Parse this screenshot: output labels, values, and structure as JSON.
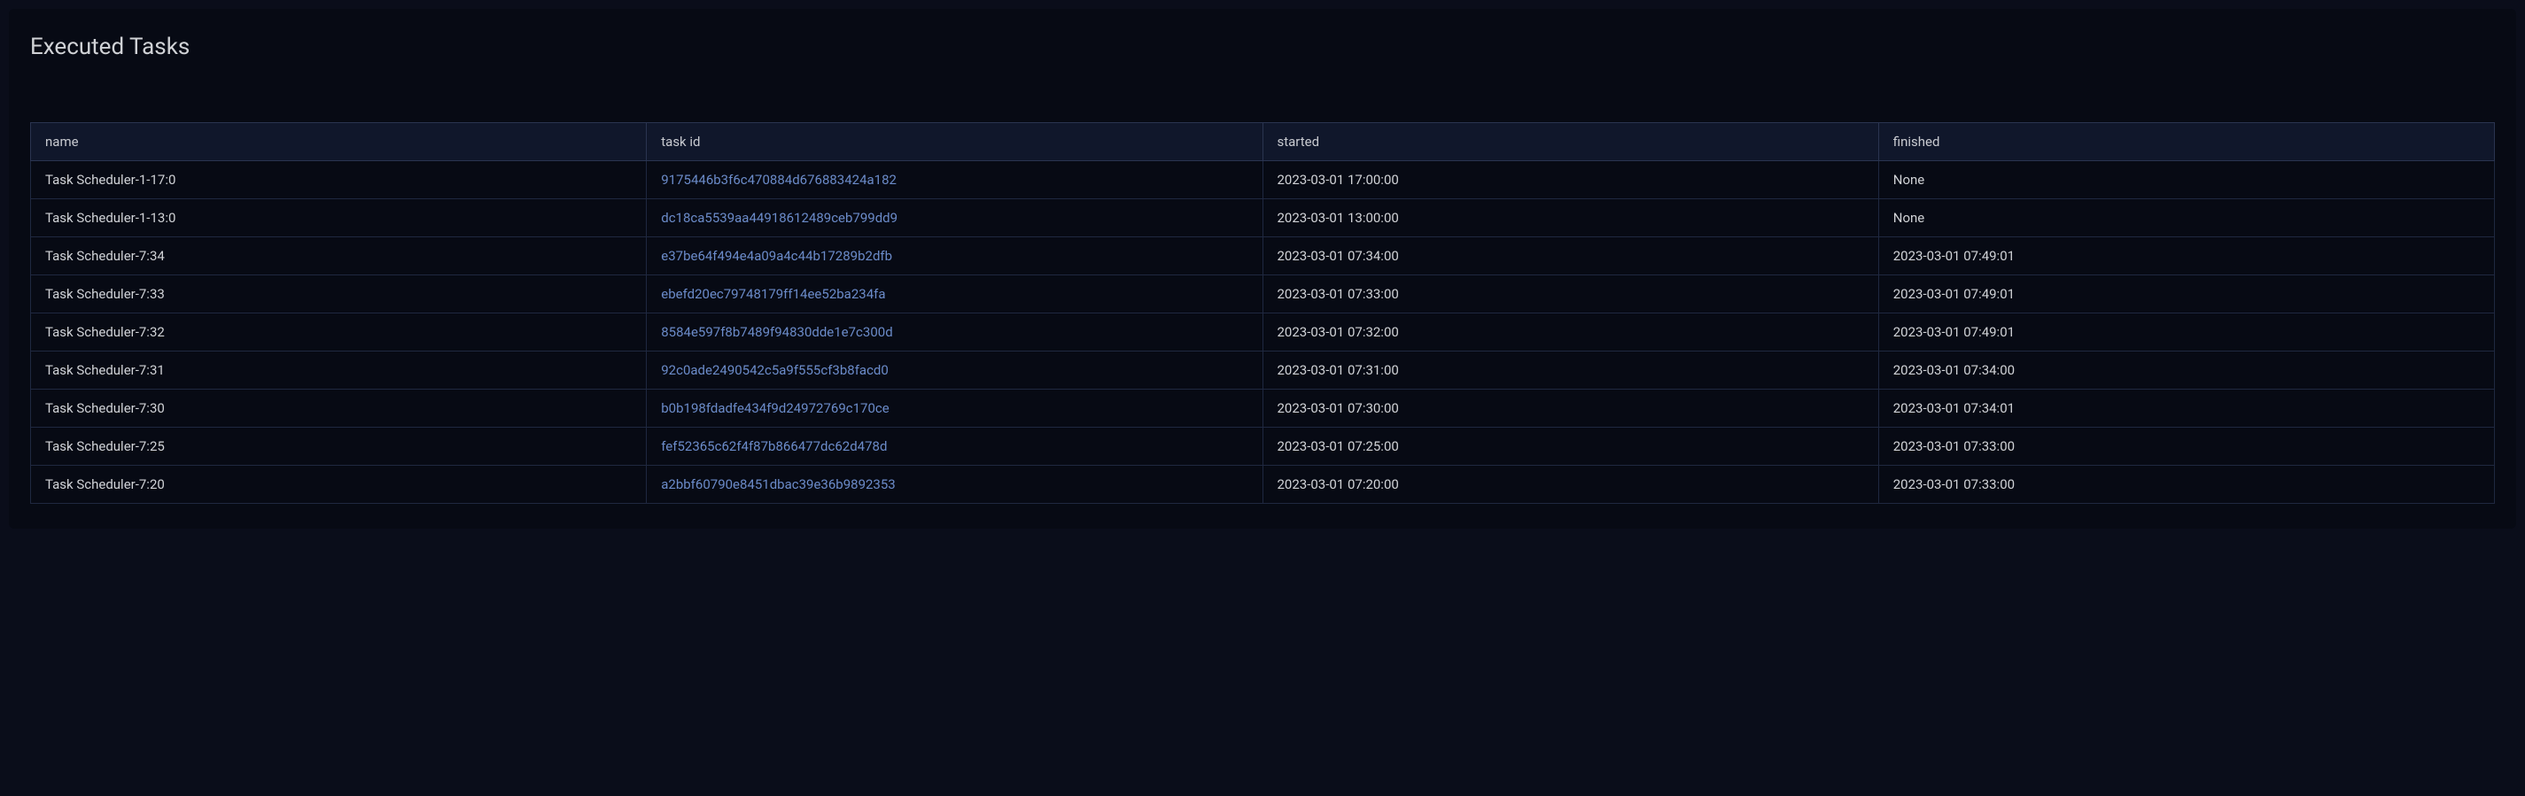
{
  "panel": {
    "title": "Executed Tasks"
  },
  "table": {
    "headers": {
      "name": "name",
      "task_id": "task id",
      "started": "started",
      "finished": "finished"
    },
    "rows": [
      {
        "name": "Task Scheduler-1-17:0",
        "task_id": "9175446b3f6c470884d676883424a182",
        "started": "2023-03-01 17:00:00",
        "finished": "None"
      },
      {
        "name": "Task Scheduler-1-13:0",
        "task_id": "dc18ca5539aa44918612489ceb799dd9",
        "started": "2023-03-01 13:00:00",
        "finished": "None"
      },
      {
        "name": "Task Scheduler-7:34",
        "task_id": "e37be64f494e4a09a4c44b17289b2dfb",
        "started": "2023-03-01 07:34:00",
        "finished": "2023-03-01 07:49:01"
      },
      {
        "name": "Task Scheduler-7:33",
        "task_id": "ebefd20ec79748179ff14ee52ba234fa",
        "started": "2023-03-01 07:33:00",
        "finished": "2023-03-01 07:49:01"
      },
      {
        "name": "Task Scheduler-7:32",
        "task_id": "8584e597f8b7489f94830dde1e7c300d",
        "started": "2023-03-01 07:32:00",
        "finished": "2023-03-01 07:49:01"
      },
      {
        "name": "Task Scheduler-7:31",
        "task_id": "92c0ade2490542c5a9f555cf3b8facd0",
        "started": "2023-03-01 07:31:00",
        "finished": "2023-03-01 07:34:00"
      },
      {
        "name": "Task Scheduler-7:30",
        "task_id": "b0b198fdadfe434f9d24972769c170ce",
        "started": "2023-03-01 07:30:00",
        "finished": "2023-03-01 07:34:01"
      },
      {
        "name": "Task Scheduler-7:25",
        "task_id": "fef52365c62f4f87b866477dc62d478d",
        "started": "2023-03-01 07:25:00",
        "finished": "2023-03-01 07:33:00"
      },
      {
        "name": "Task Scheduler-7:20",
        "task_id": "a2bbf60790e8451dbac39e36b9892353",
        "started": "2023-03-01 07:20:00",
        "finished": "2023-03-01 07:33:00"
      }
    ]
  }
}
